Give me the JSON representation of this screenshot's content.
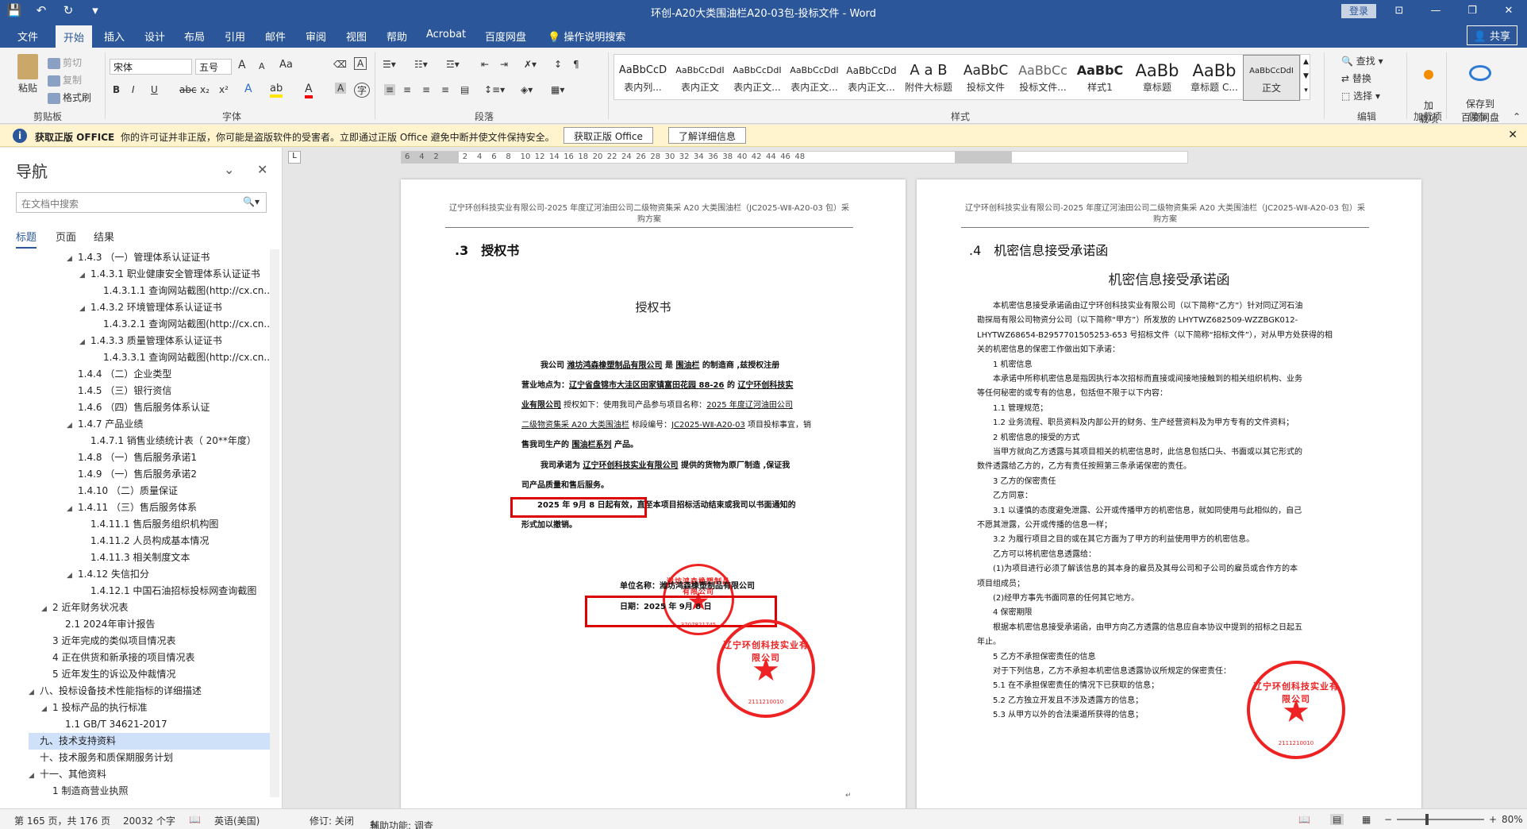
{
  "window": {
    "title": "环创-A20大类围油栏A20-03包-投标文件 - Word",
    "login": "登录",
    "quick_access": [
      "save-icon",
      "undo-icon",
      "redo-icon",
      "customize-icon"
    ]
  },
  "menu": {
    "tabs": [
      "文件",
      "开始",
      "插入",
      "设计",
      "布局",
      "引用",
      "邮件",
      "审阅",
      "视图",
      "帮助",
      "Acrobat",
      "百度网盘"
    ],
    "active": "开始",
    "tellme": "操作说明搜索",
    "share": "共享"
  },
  "ribbon": {
    "clipboard": {
      "paste": "粘贴",
      "cut": "剪切",
      "copy": "复制",
      "format_painter": "格式刷",
      "label": "剪贴板"
    },
    "font": {
      "name": "宋体",
      "size": "五号",
      "label": "字体",
      "bold": "B",
      "italic": "I",
      "underline": "U",
      "strike": "abc",
      "sub": "x₂",
      "sup": "x²",
      "grow": "A",
      "shrink": "A",
      "case": "Aa"
    },
    "paragraph": {
      "label": "段落"
    },
    "styles": {
      "label": "样式",
      "items": [
        {
          "sample": "AaBbCcD",
          "name": "表内列..."
        },
        {
          "sample": "AaBbCcDdI",
          "name": "表内正文"
        },
        {
          "sample": "AaBbCcDdI",
          "name": "表内正文..."
        },
        {
          "sample": "AaBbCcDdI",
          "name": "表内正文..."
        },
        {
          "sample": "AaBbCcDd",
          "name": "表内正文..."
        },
        {
          "sample": "A a B",
          "name": "附件大标题"
        },
        {
          "sample": "AaBbC",
          "name": "投标文件"
        },
        {
          "sample": "AaBbCc",
          "name": "投标文件..."
        },
        {
          "sample": "AaBbC",
          "name": "样式1"
        },
        {
          "sample": "AaBb",
          "name": "章标题"
        },
        {
          "sample": "AaBb",
          "name": "章标题 C..."
        },
        {
          "sample": "AaBbCcDdI",
          "name": "正文"
        }
      ]
    },
    "editing": {
      "find": "查找",
      "replace": "替换",
      "select": "选择",
      "label": "编辑"
    },
    "addins": {
      "btn": "加\n载项",
      "label": "加载项"
    },
    "save": {
      "btn": "保存到\n百度网盘",
      "label": "保存"
    }
  },
  "infobar": {
    "title": "获取正版 OFFICE",
    "message": "你的许可证并非正版，你可能是盗版软件的受害者。立即通过正版 Office 避免中断并使文件保持安全。",
    "btn1": "获取正版 Office",
    "btn2": "了解详细信息"
  },
  "nav": {
    "title": "导航",
    "search_placeholder": "在文档中搜索",
    "tabs": [
      "标题",
      "页面",
      "结果"
    ],
    "items": [
      {
        "text": "1.4.3 （一）管理体系认证证书",
        "level": 3,
        "tw": "◢"
      },
      {
        "text": "1.4.3.1 职业健康安全管理体系认证证书",
        "level": 4,
        "tw": "◢"
      },
      {
        "text": "1.4.3.1.1 查询网站截图(http://cx.cn...",
        "level": 5,
        "tw": ""
      },
      {
        "text": "1.4.3.2 环境管理体系认证证书",
        "level": 4,
        "tw": "◢"
      },
      {
        "text": "1.4.3.2.1 查询网站截图(http://cx.cn...",
        "level": 5,
        "tw": ""
      },
      {
        "text": "1.4.3.3 质量管理体系认证证书",
        "level": 4,
        "tw": "◢"
      },
      {
        "text": "1.4.3.3.1 查询网站截图(http://cx.cn...",
        "level": 5,
        "tw": ""
      },
      {
        "text": "1.4.4 （二）企业类型",
        "level": 3,
        "tw": ""
      },
      {
        "text": "1.4.5 （三）银行资信",
        "level": 3,
        "tw": ""
      },
      {
        "text": "1.4.6 （四）售后服务体系认证",
        "level": 3,
        "tw": ""
      },
      {
        "text": "1.4.7 产品业绩",
        "level": 3,
        "tw": "◢"
      },
      {
        "text": "1.4.7.1 销售业绩统计表（ 20**年度）",
        "level": 4,
        "tw": ""
      },
      {
        "text": "1.4.8 （一）售后服务承诺1",
        "level": 3,
        "tw": ""
      },
      {
        "text": "1.4.9 （一）售后服务承诺2",
        "level": 3,
        "tw": ""
      },
      {
        "text": "1.4.10 （二）质量保证",
        "level": 3,
        "tw": ""
      },
      {
        "text": "1.4.11 （三）售后服务体系",
        "level": 3,
        "tw": "◢"
      },
      {
        "text": "1.4.11.1 售后服务组织机构图",
        "level": 4,
        "tw": ""
      },
      {
        "text": "1.4.11.2 人员构成基本情况",
        "level": 4,
        "tw": ""
      },
      {
        "text": "1.4.11.3 相关制度文本",
        "level": 4,
        "tw": ""
      },
      {
        "text": "1.4.12 失信扣分",
        "level": 3,
        "tw": "◢"
      },
      {
        "text": "1.4.12.1 中国石油招标投标网查询截图",
        "level": 4,
        "tw": ""
      },
      {
        "text": "2 近年财务状况表",
        "level": 1,
        "tw": "◢"
      },
      {
        "text": "2.1 2024年审计报告",
        "level": 2,
        "tw": ""
      },
      {
        "text": "3 近年完成的类似项目情况表",
        "level": 1,
        "tw": ""
      },
      {
        "text": "4 正在供货和新承接的项目情况表",
        "level": 1,
        "tw": ""
      },
      {
        "text": "5 近年发生的诉讼及仲裁情况",
        "level": 1,
        "tw": ""
      },
      {
        "text": "八、投标设备技术性能指标的详细描述",
        "level": 0,
        "tw": "◢"
      },
      {
        "text": "1 投标产品的执行标准",
        "level": 1,
        "tw": "◢"
      },
      {
        "text": "1.1 GB/T 34621-2017",
        "level": 2,
        "tw": ""
      },
      {
        "text": "九、技术支持资料",
        "level": 0,
        "tw": "",
        "selected": true
      },
      {
        "text": "十、技术服务和质保期服务计划",
        "level": 0,
        "tw": ""
      },
      {
        "text": "十一、其他资料",
        "level": 0,
        "tw": "◢"
      },
      {
        "text": "1 制造商营业执照",
        "level": 1,
        "tw": ""
      }
    ]
  },
  "ruler": {
    "ticks": [
      "6",
      "4",
      "2",
      "",
      "2",
      "4",
      "6",
      "8",
      "10",
      "12",
      "14",
      "16",
      "18",
      "20",
      "22",
      "24",
      "26",
      "28",
      "30",
      "32",
      "34",
      "36",
      "38",
      "40",
      "42",
      "44",
      "46",
      "48"
    ]
  },
  "page1": {
    "header": "辽宁环创科技实业有限公司-2025 年度辽河油田公司二级物资集采 A20 大类围油栏（JC2025-WⅡ-A20-03 包）采购方案",
    "section": ".3　授权书",
    "title": "授权书",
    "para1_a": "我公司 ",
    "para1_b": "潍坊鸿森橡塑制品有限公司",
    "para1_c": " 是 ",
    "para1_d": "围油栏",
    "para1_e": " 的制造商 ,兹授权注册",
    "para2_a": "营业地点为：",
    "para2_b": "辽宁省盘锦市大洼区田家镇富田花园 88-26",
    "para2_c": " 的 ",
    "para2_d": "辽宁环创科技实",
    "para3_a": "业有限公司",
    "para3_b": " 授权如下：使用我司产品参与项目名称：",
    "para3_c": "2025 年度辽河油田公司",
    "para4_a": "二级物资集采 A20 大类围油栏",
    "para4_b": " 标段编号：",
    "para4_c": "JC2025-WⅡ-A20-03",
    "para4_d": " 项目投标事宜，销",
    "para5_a": "售我司生产的 ",
    "para5_b": "围油栏系列",
    "para5_c": " 产品。",
    "para6_a": "我司承诺为 ",
    "para6_b": "辽宁环创科技实业有限公司",
    "para6_c": " 提供的货物为原厂制造 ,保证我",
    "para7": "司产品质量和售后服务。",
    "para8_a": "2025 年 9月  8 日起有效，直",
    "para8_b": "至本项目招标活动结束或我司以书面通知的",
    "para9": "形式加以撤销。",
    "sign_label": "单位名称：",
    "sign_value": "潍坊鸿森橡塑制品有限公司",
    "date_line": "日期：2025 年 9月 8 日",
    "stamp1_text": "潍坊鸿森橡塑制品有限公司",
    "stamp1_num": "3707821745",
    "stamp2_text": "辽宁环创科技实业有限公司",
    "stamp2_num": "2111210010"
  },
  "page2": {
    "header": "辽宁环创科技实业有限公司-2025 年度辽河油田公司二级物资集采 A20 大类围油栏（JC2025-WⅡ-A20-03 包）采购方案",
    "section": ".4　机密信息接受承诺函",
    "title": "机密信息接受承诺函",
    "lines": [
      "　　本机密信息接受承诺函由辽宁环创科技实业有限公司（以下简称“乙方”）针对同辽河石油",
      "勘探局有限公司物资分公司（以下简称“甲方”）所发放的 LHYTWZ682509-WZZBGK012-",
      "LHYTWZ68654-B2957701505253-653 号招标文件（以下简称“招标文件”），对从甲方处获得的相",
      "关的机密信息的保密工作做出如下承诺：",
      "　　1 机密信息",
      "　　本承诺中所称机密信息是指因执行本次招标而直接或间接地接触到的相关组织机构、业务",
      "等任何秘密的或专有的信息，包括但不限于以下内容：",
      "　　1.1 管理规范；",
      "　　1.2 业务流程、职员资料及内部公开的财务、生产经营资料及为甲方专有的文件资料；",
      "　　2 机密信息的接受的方式",
      "　　当甲方就向乙方透露与其项目相关的机密信息时，此信息包括口头、书面或以其它形式的",
      "数件透露给乙方的，乙方有责任按照第三条承诺保密的责任。",
      "　　3 乙方的保密责任",
      "　　乙方同意：",
      "　　3.1 以谨慎的态度避免泄露、公开或传播甲方的机密信息，就如同使用与此相似的，自己",
      "不愿其泄露，公开或传播的信息一样；",
      "　　3.2 为履行项目之目的或在其它方面为了甲方的利益使用甲方的机密信息。",
      "　　乙方可以将机密信息透露给：",
      "　　(1)为项目进行必须了解该信息的其本身的雇员及其母公司和子公司的雇员或合作方的本",
      "项目组成员；",
      "　　(2)经甲方事先书面同意的任何其它地方。",
      "　　4 保密期限",
      "　　根据本机密信息接受承诺函，由甲方向乙方透露的信息应自本协议中提到的招标之日起五",
      "年止。",
      "　　5 乙方不承担保密责任的信息",
      "　　对于下列信息，乙方不承担本机密信息透露协议所规定的保密责任：",
      "　　5.1 在不承担保密责任的情况下已获取的信息；",
      "　　5.2 乙方独立开发且不涉及透露方的信息；",
      "　　5.3 从甲方以外的合法渠道所获得的信息；"
    ]
  },
  "status": {
    "page": "第 165 页，共 176 页",
    "words": "20032 个字",
    "lang": "英语(美国)",
    "track": "修订: 关闭",
    "access": "辅助功能: 调查",
    "zoom": "80%"
  }
}
